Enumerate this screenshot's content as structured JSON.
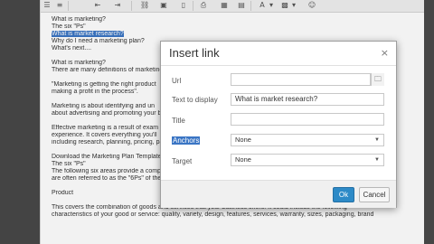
{
  "toolbar": {
    "icons": [
      "bullet-list-icon",
      "numbered-list-icon",
      "outdent-icon",
      "indent-icon",
      "link-icon",
      "image-icon",
      "bookmark-icon",
      "print-icon",
      "table-icon",
      "format-icon",
      "text-color-icon",
      "background-color-icon",
      "emoticon-icon"
    ]
  },
  "content": {
    "lines": [
      "What is marketing?",
      "The six \"Ps\"",
      "What is market research?",
      "Why do I need a marketing plan?",
      "What's next....",
      "",
      "What is marketing?",
      "There are many definitions of marketing",
      "",
      "\"Marketing is getting the right product",
      "making a profit in the process\".",
      "",
      "Marketing is about identifying and un",
      "about advertising and promoting your b",
      "",
      "Effective marketing is a result of exam",
      "experience. It covers everything you'll",
      "including research, planning, pricing, pa",
      "",
      "Download the Marketing Plan Template",
      "The six \"Ps\"",
      "The following six areas provide a compr",
      "are often referred to as the \"6Ps\" of the marketing mix:",
      "",
      "Product",
      "",
      "This covers the combination of goods and services that your business offers. It could include the following",
      "characteristics of your good or service: quality, variety, design, features, services, warranty, sizes, packaging, brand"
    ]
  },
  "dialog": {
    "title": "Insert link",
    "close": "×",
    "url_label": "Url",
    "url_value": "",
    "text_label": "Text to display",
    "text_value": "What is market research?",
    "title_label": "Title",
    "title_value": "",
    "anchors_label": "Anchors",
    "anchors_value": "None",
    "target_label": "Target",
    "target_value": "None",
    "ok": "Ok",
    "cancel": "Cancel"
  }
}
